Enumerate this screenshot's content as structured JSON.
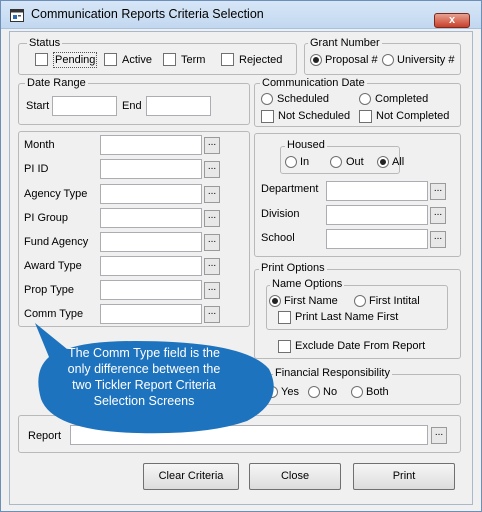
{
  "window": {
    "title": "Communication Reports Criteria Selection",
    "close_label": "x"
  },
  "status": {
    "caption": "Status",
    "options": [
      {
        "label": "Pending",
        "checked": false
      },
      {
        "label": "Active",
        "checked": false
      },
      {
        "label": "Term",
        "checked": false
      },
      {
        "label": "Rejected",
        "checked": false
      }
    ]
  },
  "grant_number": {
    "caption": "Grant Number",
    "options": [
      {
        "label": "Proposal #",
        "selected": true
      },
      {
        "label": "University #",
        "selected": false
      }
    ]
  },
  "date_range": {
    "caption": "Date Range",
    "start_label": "Start",
    "start_value": "",
    "end_label": "End",
    "end_value": ""
  },
  "communication_date": {
    "caption": "Communication Date",
    "radios": [
      {
        "label": "Scheduled",
        "selected": false
      },
      {
        "label": "Completed",
        "selected": false
      }
    ],
    "checks": [
      {
        "label": "Not Scheduled",
        "checked": false
      },
      {
        "label": "Not Completed",
        "checked": false
      }
    ]
  },
  "left_fields": [
    {
      "label": "Month",
      "value": ""
    },
    {
      "label": "PI ID",
      "value": ""
    },
    {
      "label": "Agency Type",
      "value": ""
    },
    {
      "label": "PI Group",
      "value": ""
    },
    {
      "label": "Fund Agency",
      "value": ""
    },
    {
      "label": "Award Type",
      "value": ""
    },
    {
      "label": "Prop Type",
      "value": ""
    },
    {
      "label": "Comm Type",
      "value": ""
    }
  ],
  "ellipsis": "...",
  "housed": {
    "caption": "Housed",
    "options": [
      {
        "label": "In",
        "selected": false
      },
      {
        "label": "Out",
        "selected": false
      },
      {
        "label": "All",
        "selected": true
      }
    ]
  },
  "right_fields": [
    {
      "label": "Department",
      "value": ""
    },
    {
      "label": "Division",
      "value": ""
    },
    {
      "label": "School",
      "value": ""
    }
  ],
  "print_options": {
    "caption": "Print Options",
    "name_options_caption": "Name Options",
    "name_radios": [
      {
        "label": "First Name",
        "selected": true
      },
      {
        "label": "First Intital",
        "selected": false
      }
    ],
    "print_last_first": {
      "label": "Print Last Name First",
      "checked": false
    },
    "exclude_date": {
      "label": "Exclude Date From Report",
      "checked": false
    }
  },
  "financial_responsibility": {
    "caption": "Financial Responsibility",
    "options": [
      {
        "label": "Yes",
        "selected": false
      },
      {
        "label": "No",
        "selected": false
      },
      {
        "label": "Both",
        "selected": false
      }
    ]
  },
  "report": {
    "label": "Report",
    "value": ""
  },
  "buttons": {
    "clear": "Clear Criteria",
    "close": "Close",
    "print": "Print"
  },
  "callout": {
    "text": "The Comm Type field is the only difference between the two Tickler Report Criteria Selection Screens",
    "color": "#1e73be"
  }
}
